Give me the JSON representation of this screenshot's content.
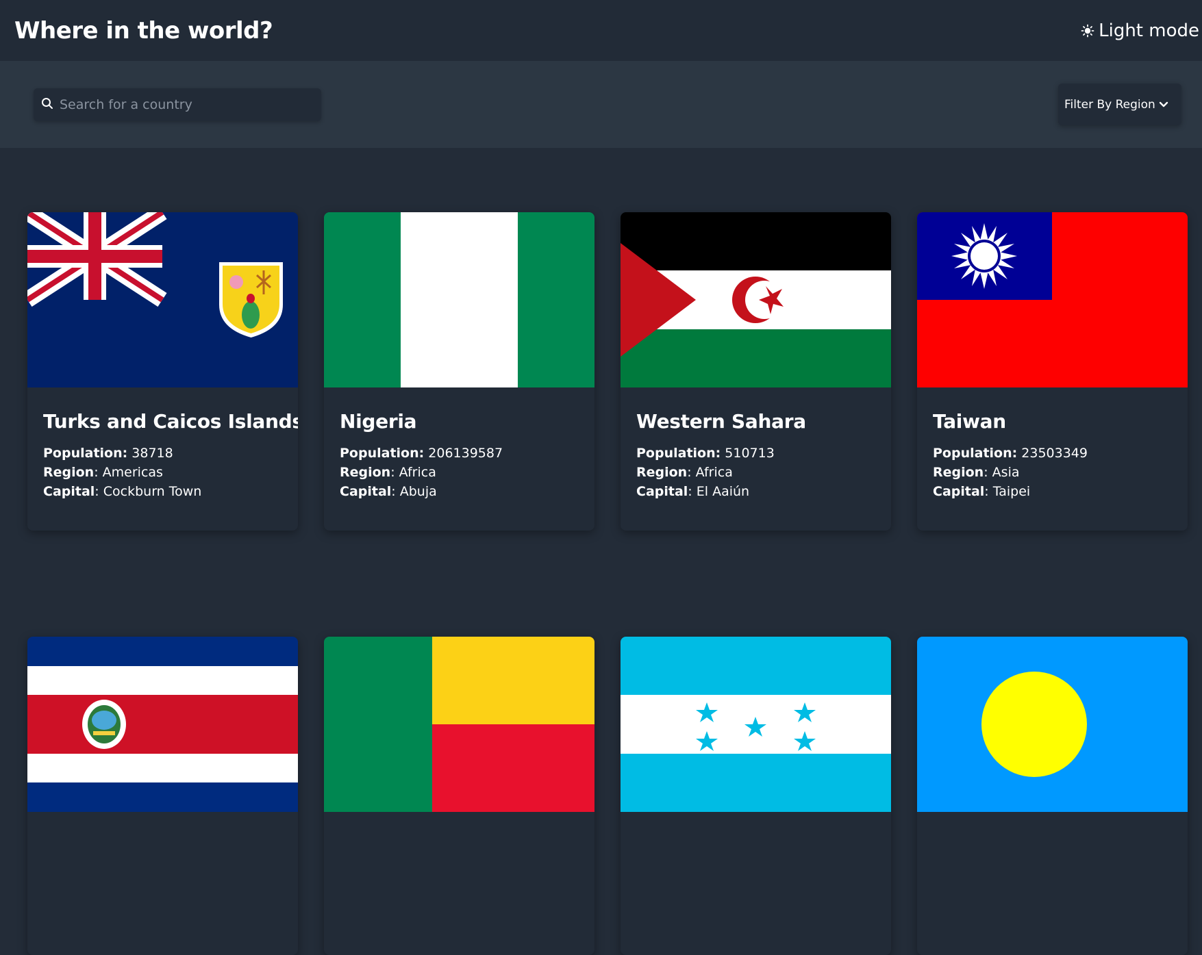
{
  "header": {
    "title": "Where in the world?",
    "mode_label": "Light mode"
  },
  "toolbar": {
    "search_placeholder": "Search for a country",
    "search_value": "",
    "filter_label": "Filter By Region"
  },
  "labels": {
    "population": "Population:",
    "region": "Region",
    "capital": "Capital"
  },
  "countries": [
    {
      "name": "Turks and Caicos Islands",
      "population": "38718",
      "region": "Americas",
      "capital": "Cockburn Town",
      "flag_icon": "turks-and-caicos-flag-icon"
    },
    {
      "name": "Nigeria",
      "population": "206139587",
      "region": "Africa",
      "capital": "Abuja",
      "flag_icon": "nigeria-flag-icon"
    },
    {
      "name": "Western Sahara",
      "population": "510713",
      "region": "Africa",
      "capital": "El Aaiún",
      "flag_icon": "western-sahara-flag-icon"
    },
    {
      "name": "Taiwan",
      "population": "23503349",
      "region": "Asia",
      "capital": "Taipei",
      "flag_icon": "taiwan-flag-icon"
    },
    {
      "flag_icon": "costa-rica-flag-icon"
    },
    {
      "flag_icon": "benin-flag-icon"
    },
    {
      "flag_icon": "honduras-flag-icon"
    },
    {
      "flag_icon": "palau-flag-icon"
    }
  ],
  "colors": {
    "background": "#232c38",
    "header": "#222b37",
    "toolbar": "#2c3743",
    "card": "#222b37",
    "text": "#ffffff"
  }
}
